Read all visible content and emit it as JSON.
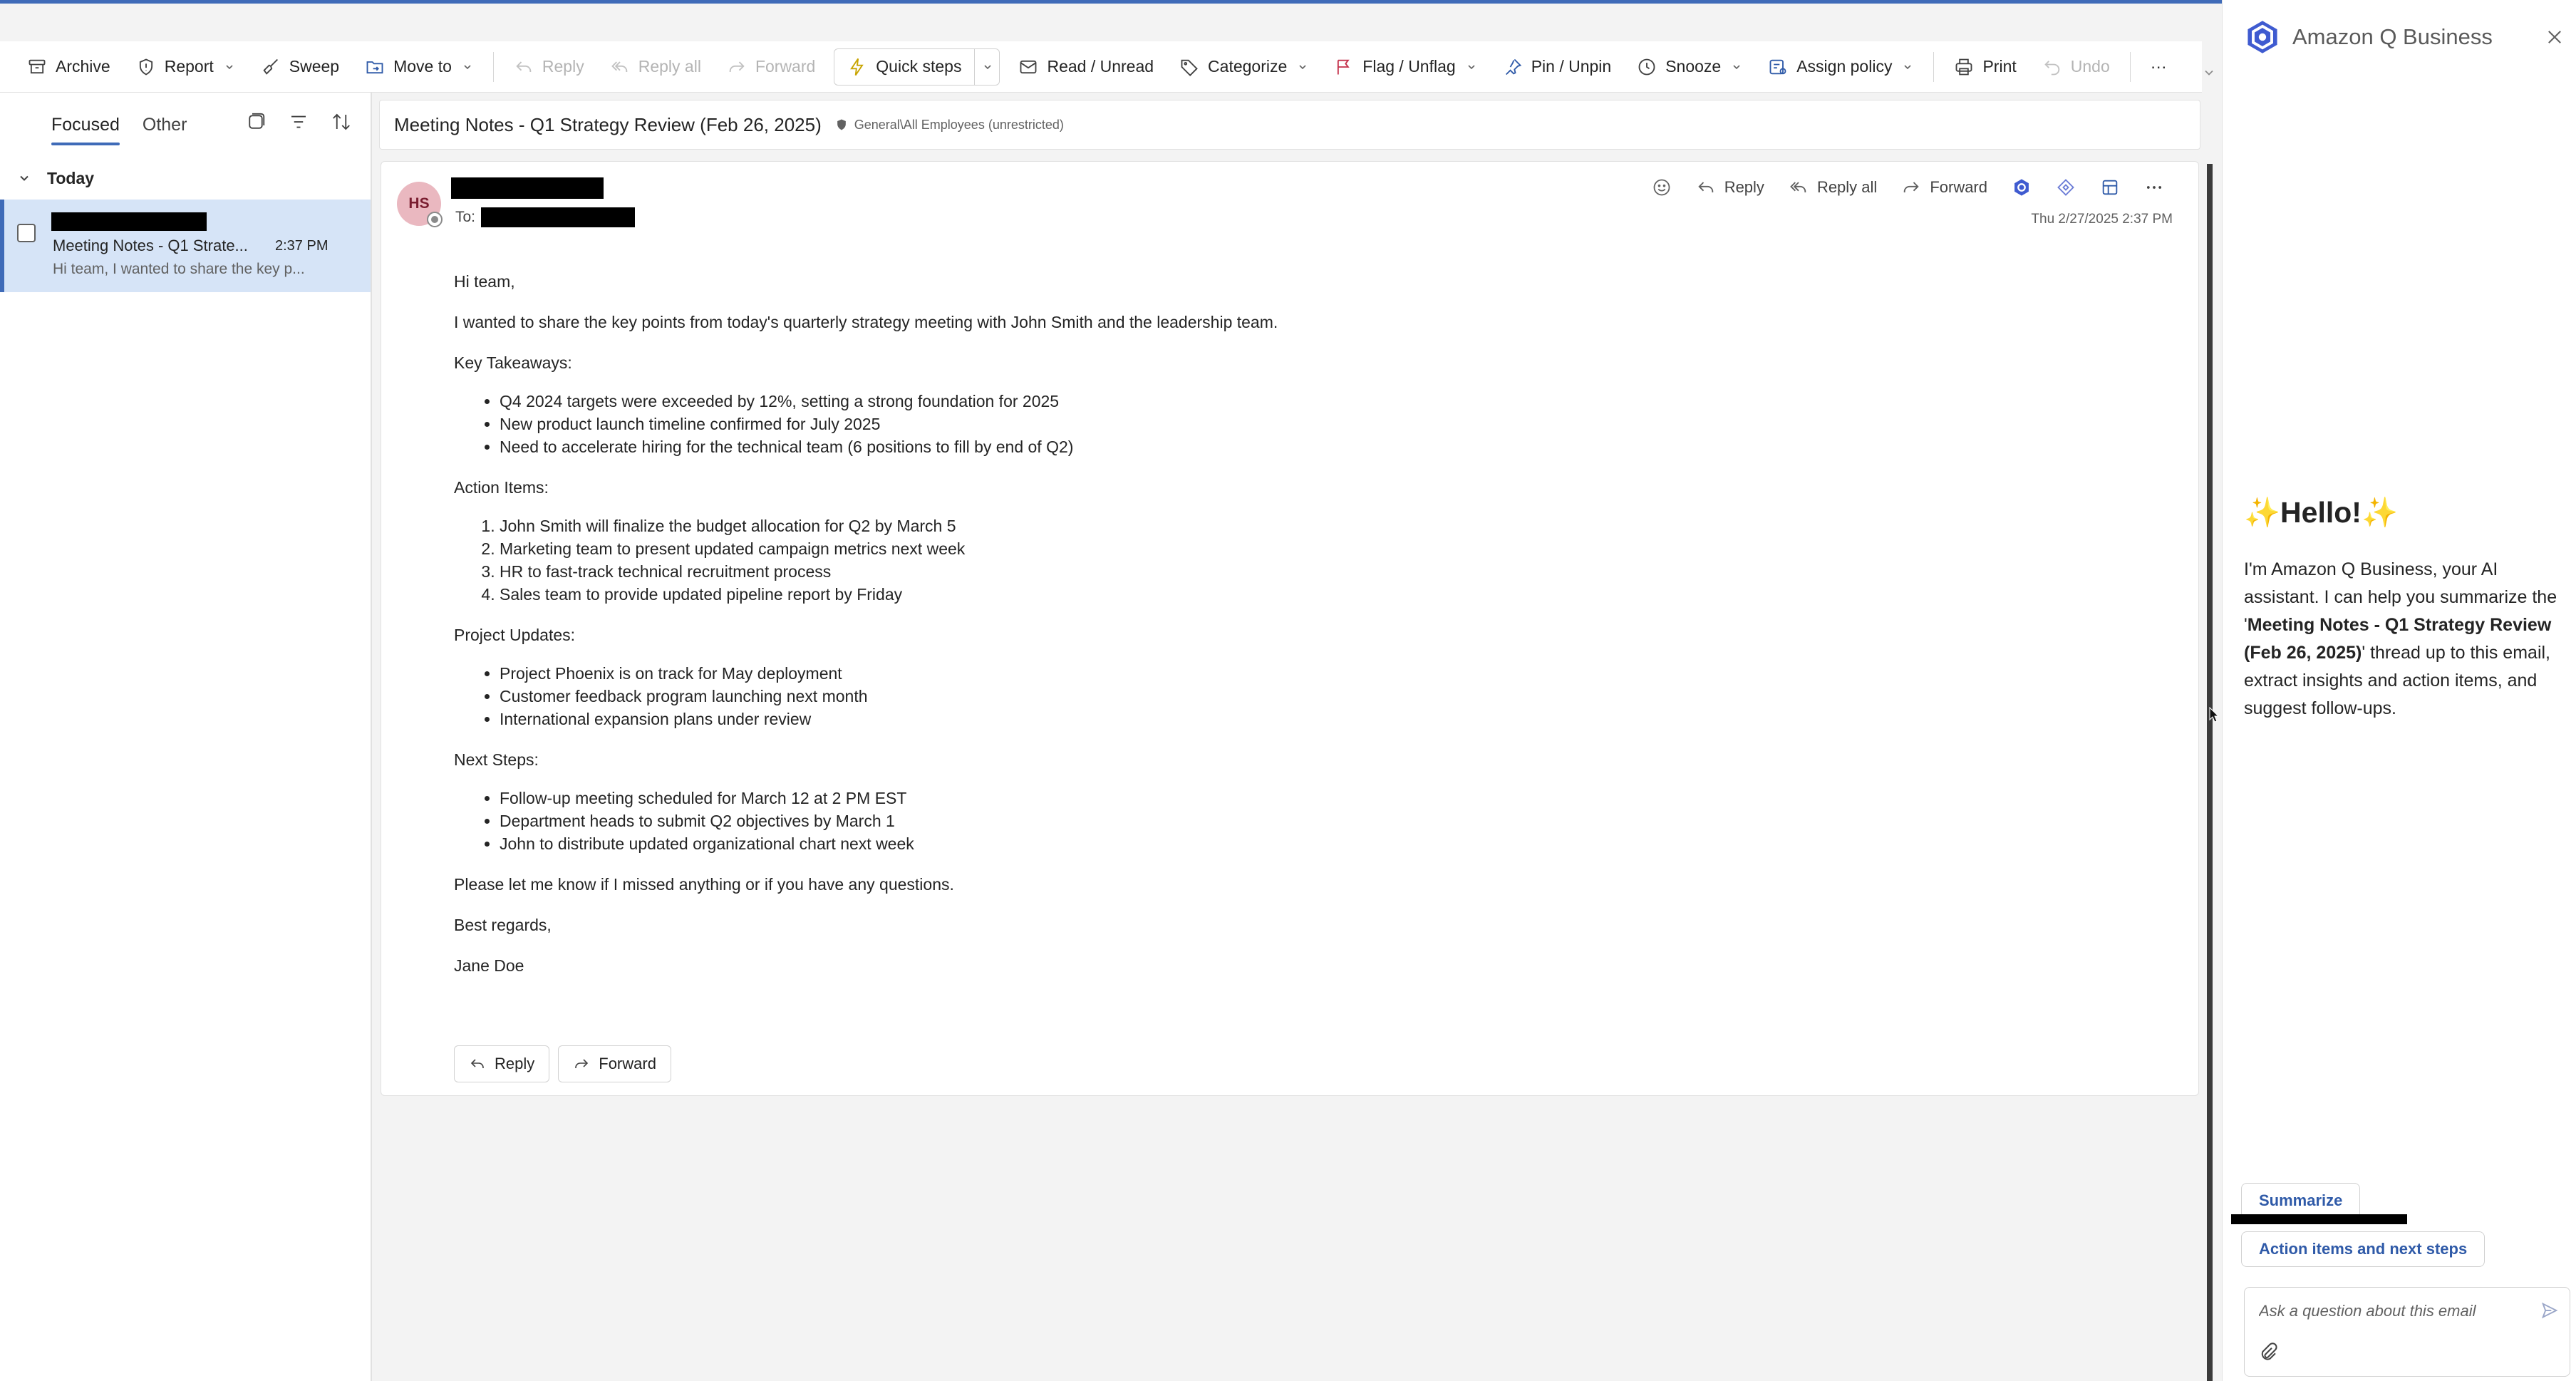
{
  "toolbar": {
    "archive": "Archive",
    "report": "Report",
    "sweep": "Sweep",
    "move_to": "Move to",
    "reply": "Reply",
    "reply_all": "Reply all",
    "forward": "Forward",
    "quick_steps": "Quick steps",
    "read_unread": "Read / Unread",
    "categorize": "Categorize",
    "flag_unflag": "Flag / Unflag",
    "pin_unpin": "Pin / Unpin",
    "snooze": "Snooze",
    "assign_policy": "Assign policy",
    "print": "Print",
    "undo": "Undo",
    "more": "···"
  },
  "message_list": {
    "tabs": [
      "Focused",
      "Other"
    ],
    "group_label": "Today",
    "items": [
      {
        "subject": "Meeting Notes - Q1 Strate...",
        "time": "2:37 PM",
        "preview": "Hi team, I wanted to share the key p..."
      }
    ]
  },
  "reading_pane": {
    "subject": "Meeting Notes - Q1 Strategy Review (Feb 26, 2025)",
    "sensitivity": "General\\All Employees (unrestricted)",
    "avatar_initials": "HS",
    "to_label": "To:",
    "date": "Thu 2/27/2025 2:37 PM",
    "actions": {
      "reply": "Reply",
      "reply_all": "Reply all",
      "forward": "Forward"
    },
    "body": {
      "greeting": "Hi team,",
      "intro": "I wanted to share the key points from today's quarterly strategy meeting with John Smith and the leadership team.",
      "takeaways_heading": "Key Takeaways:",
      "takeaways": [
        "Q4 2024 targets were exceeded by 12%, setting a strong foundation for 2025",
        "New product launch timeline confirmed for July 2025",
        "Need to accelerate hiring for the technical team (6 positions to fill by end of Q2)"
      ],
      "actions_heading": "Action Items:",
      "action_items": [
        "John Smith will finalize the budget allocation for Q2 by March 5",
        "Marketing team to present updated campaign metrics next week",
        "HR to fast-track technical recruitment process",
        "Sales team to provide updated pipeline report by Friday"
      ],
      "updates_heading": "Project Updates:",
      "updates": [
        "Project Phoenix is on track for May deployment",
        "Customer feedback program launching next month",
        "International expansion plans under review"
      ],
      "next_heading": "Next Steps:",
      "next_steps": [
        "Follow-up meeting scheduled for March 12 at 2 PM EST",
        "Department heads to submit Q2 objectives by March 1",
        "John to distribute updated organizational chart next week"
      ],
      "closing_line": "Please let me know if I missed anything or if you have any questions.",
      "sign_off": "Best regards,",
      "signature": "Jane Doe"
    },
    "footer_buttons": {
      "reply": "Reply",
      "forward": "Forward"
    }
  },
  "amazon_q": {
    "title": "Amazon Q Business",
    "hello": "✨Hello!✨",
    "intro_prefix": "I'm Amazon Q Business, your AI assistant. I can help you summarize the '",
    "intro_subject": "Meeting Notes - Q1 Strategy Review (Feb 26, 2025)",
    "intro_suffix": "' thread up to this email, extract insights and action items, and suggest follow-ups.",
    "chips": {
      "summarize": "Summarize",
      "action_items": "Action items and next steps"
    },
    "input_placeholder": "Ask a question about this email"
  },
  "colors": {
    "accent": "#3f6bb8",
    "selected_row": "#d6e4f7",
    "q_chip_text": "#2f5aa8",
    "avatar_bg": "#eab8c0"
  }
}
